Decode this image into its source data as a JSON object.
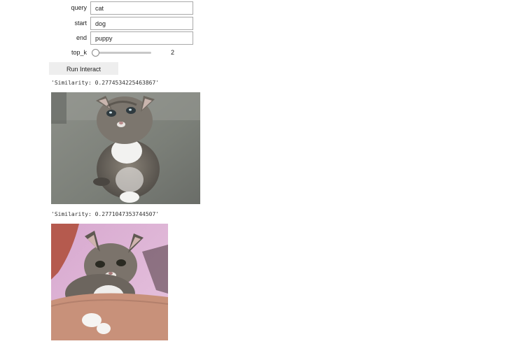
{
  "form": {
    "query": {
      "label": "query",
      "value": "cat"
    },
    "start": {
      "label": "start",
      "value": "dog"
    },
    "end": {
      "label": "end",
      "value": "puppy"
    },
    "top_k": {
      "label": "top_k",
      "value": "2",
      "slider_fraction": 0.0
    },
    "run_button": "Run Interact"
  },
  "results": [
    {
      "similarity_text": "'Similarity: 0.2774534225463867'",
      "image": "kitten sitting on gray carpet"
    },
    {
      "similarity_text": "'Similarity: 0.2771047353744507'",
      "image": "kitten held in arms against pink shirt"
    }
  ]
}
